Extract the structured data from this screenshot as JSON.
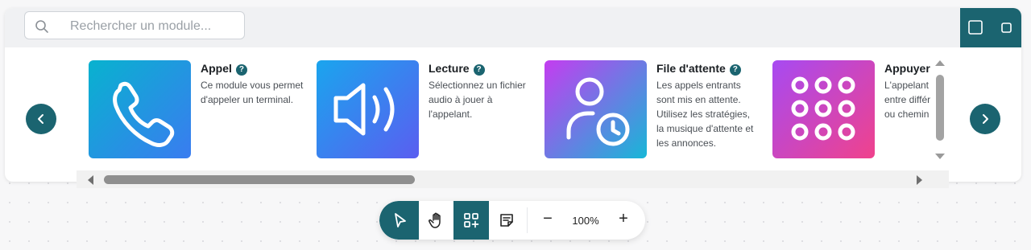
{
  "search": {
    "placeholder": "Rechercher un module..."
  },
  "carousel": {
    "cards": [
      {
        "title": "Appel",
        "help": "?",
        "description": "Ce module vous permet d'appeler un terminal.",
        "icon": "phone-icon"
      },
      {
        "title": "Lecture",
        "help": "?",
        "description": "Sélectionnez un fichier audio à jouer à l'appelant.",
        "icon": "speaker-icon"
      },
      {
        "title": "File d'attente",
        "help": "?",
        "description": "Les appels entrants sont mis en attente. Utilisez les stratégies, la musique d'attente et les annonces.",
        "icon": "user-clock-icon"
      },
      {
        "title": "Appuyer",
        "help": "?",
        "description": "L'appelant entre différ ou chemin",
        "icon": "keypad-icon"
      }
    ]
  },
  "toolbar": {
    "zoom_value": "100%",
    "zoom_out": "−",
    "zoom_in": "+"
  },
  "colors": {
    "accent": "#1b6470",
    "tile_appel": [
      "#08b2cf",
      "#3a7cf0"
    ],
    "tile_lecture": [
      "#1aa5ee",
      "#5a5ef0"
    ],
    "tile_file": [
      "#c43df0",
      "#17b7d7"
    ],
    "tile_appuyer": [
      "#a74af2",
      "#f0428c"
    ]
  }
}
